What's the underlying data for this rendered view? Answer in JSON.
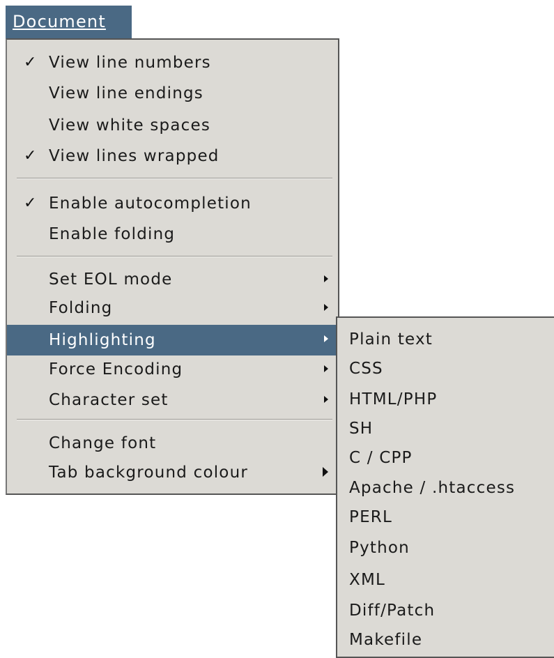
{
  "menubar": {
    "document_label": "Document"
  },
  "menu": {
    "items": [
      {
        "label": "View line numbers",
        "checked": true
      },
      {
        "label": "View line endings",
        "checked": false
      },
      {
        "label": "View white spaces",
        "checked": false
      },
      {
        "label": "View lines wrapped",
        "checked": true
      },
      {
        "label": "Enable autocompletion",
        "checked": true
      },
      {
        "label": "Enable folding",
        "checked": false
      },
      {
        "label": "Set EOL mode",
        "submenu": true
      },
      {
        "label": "Folding",
        "submenu": true
      },
      {
        "label": "Highlighting",
        "submenu": true,
        "active": true
      },
      {
        "label": "Force Encoding",
        "submenu": true
      },
      {
        "label": "Character set",
        "submenu": true
      },
      {
        "label": "Change font"
      },
      {
        "label": "Tab background colour",
        "submenu": true
      }
    ]
  },
  "check_glyph": "✓",
  "submenu": {
    "items": [
      "Plain text",
      "CSS",
      "HTML/PHP",
      "SH",
      "C / CPP",
      "Apache / .htaccess",
      "PERL",
      "Python",
      "XML",
      "Diff/Patch",
      "Makefile"
    ]
  },
  "colors": {
    "menu_bg": "#dcdad5",
    "selection_bg": "#4a6984",
    "selection_fg": "#ffffff"
  }
}
